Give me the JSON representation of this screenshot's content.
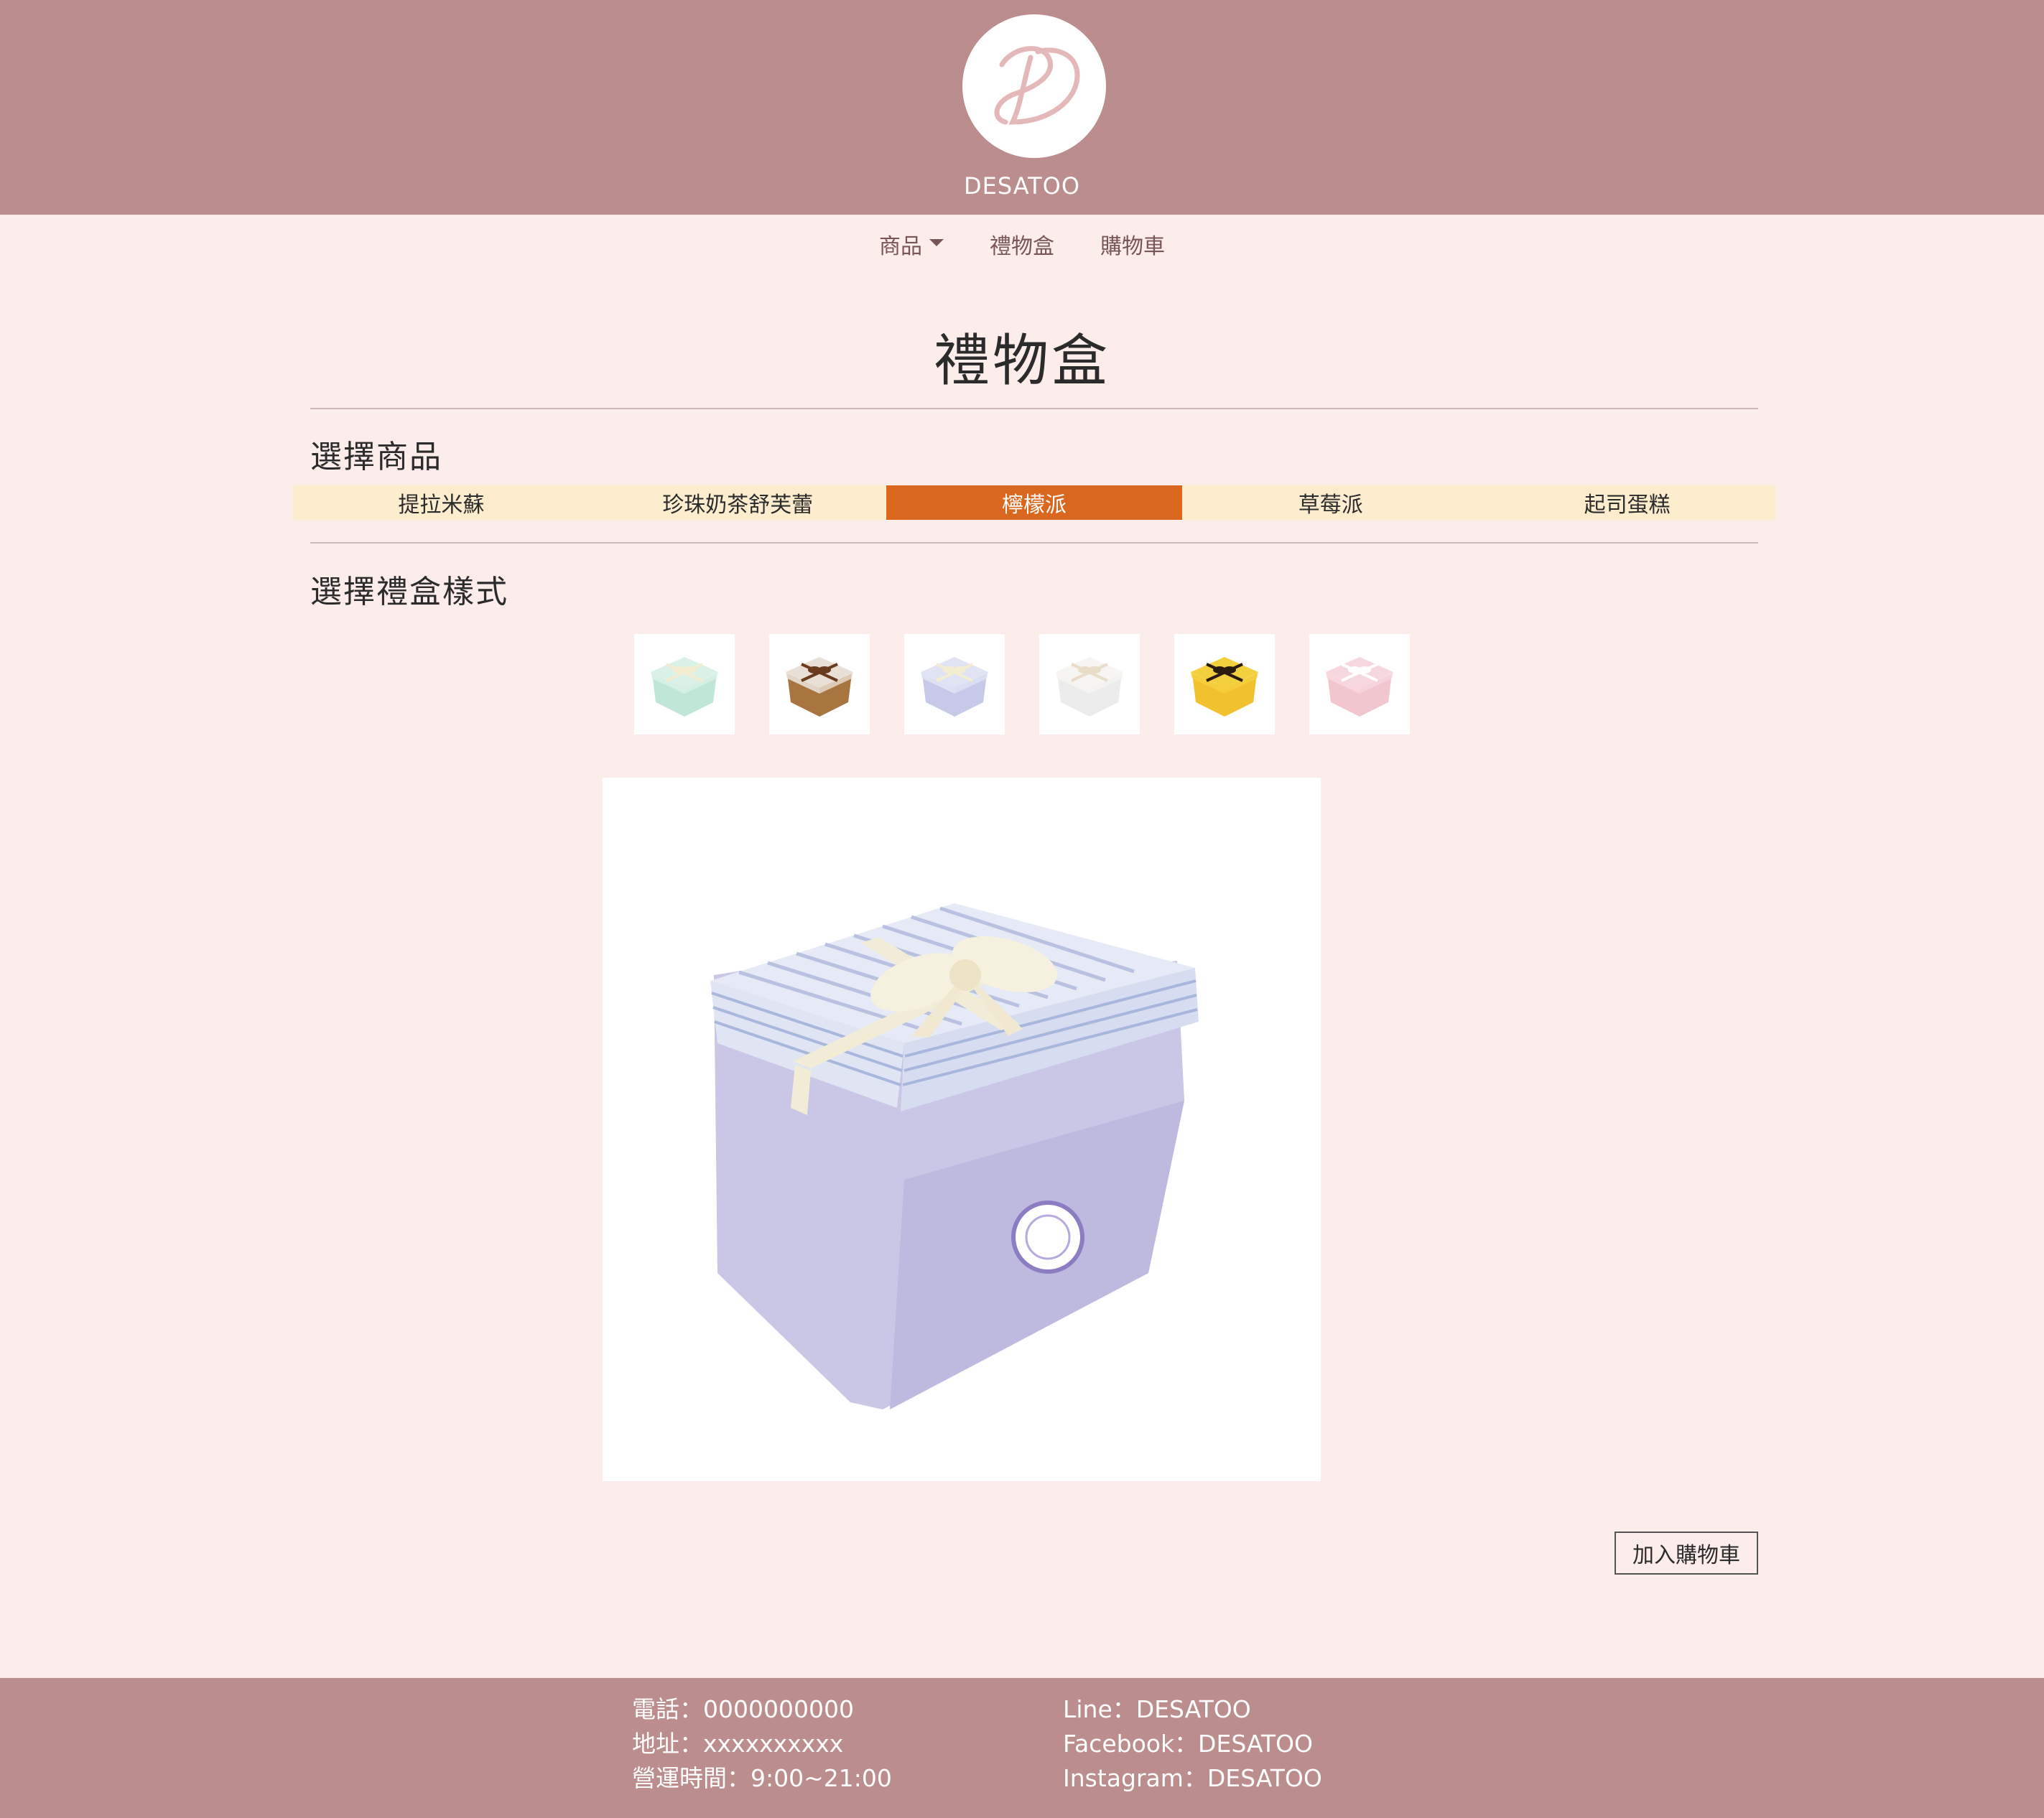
{
  "brand": {
    "name": "DESATOO",
    "logo_letter": "D"
  },
  "nav": {
    "items": [
      {
        "label": "商品",
        "has_dropdown": true
      },
      {
        "label": "禮物盒"
      },
      {
        "label": "購物車"
      }
    ]
  },
  "page": {
    "title": "禮物盒"
  },
  "product_section": {
    "heading": "選擇商品",
    "tabs": [
      {
        "label": "提拉米蘇",
        "active": false
      },
      {
        "label": "珍珠奶茶舒芙蕾",
        "active": false
      },
      {
        "label": "檸檬派",
        "active": true
      },
      {
        "label": "草莓派",
        "active": false
      },
      {
        "label": "起司蛋糕",
        "active": false
      }
    ]
  },
  "box_section": {
    "heading": "選擇禮盒樣式",
    "thumbnails": [
      {
        "name": "mint-gift-box-icon",
        "box": "#bfe6d6",
        "lid": "#d9f1e6",
        "ribbon": "#f4ecd0"
      },
      {
        "name": "brown-gift-box-icon",
        "box": "#a8743f",
        "lid": "#e8e0d6",
        "ribbon": "#6b3b1e"
      },
      {
        "name": "lavender-gift-box-icon",
        "box": "#c7c9e8",
        "lid": "#dfe3f4",
        "ribbon": "#f4ecd0"
      },
      {
        "name": "white-gift-box-icon",
        "box": "#ececec",
        "lid": "#f7f5f2",
        "ribbon": "#e9dcc8"
      },
      {
        "name": "yellow-gift-box-icon",
        "box": "#f2c12e",
        "lid": "#f4cf3d",
        "ribbon": "#2b1a10"
      },
      {
        "name": "pink-gift-box-icon",
        "box": "#f2c6cf",
        "lid": "#f7d7de",
        "ribbon": "#ffffff"
      }
    ],
    "selected_index": 2
  },
  "actions": {
    "add_to_cart": "加入購物車"
  },
  "footer": {
    "left": [
      {
        "label": "電話：0000000000"
      },
      {
        "label": "地址：xxxxxxxxxx"
      },
      {
        "label": "營運時間：9:00~21:00"
      }
    ],
    "right": [
      {
        "label": "Line：DESATOO"
      },
      {
        "label": "Facebook：DESATOO"
      },
      {
        "label": "Instagram：DESATOO"
      }
    ]
  },
  "colors": {
    "header_bg": "#bb8d8c",
    "page_bg": "#fcecea",
    "tab_bg": "#fdeccd",
    "tab_active": "#d9681e"
  }
}
